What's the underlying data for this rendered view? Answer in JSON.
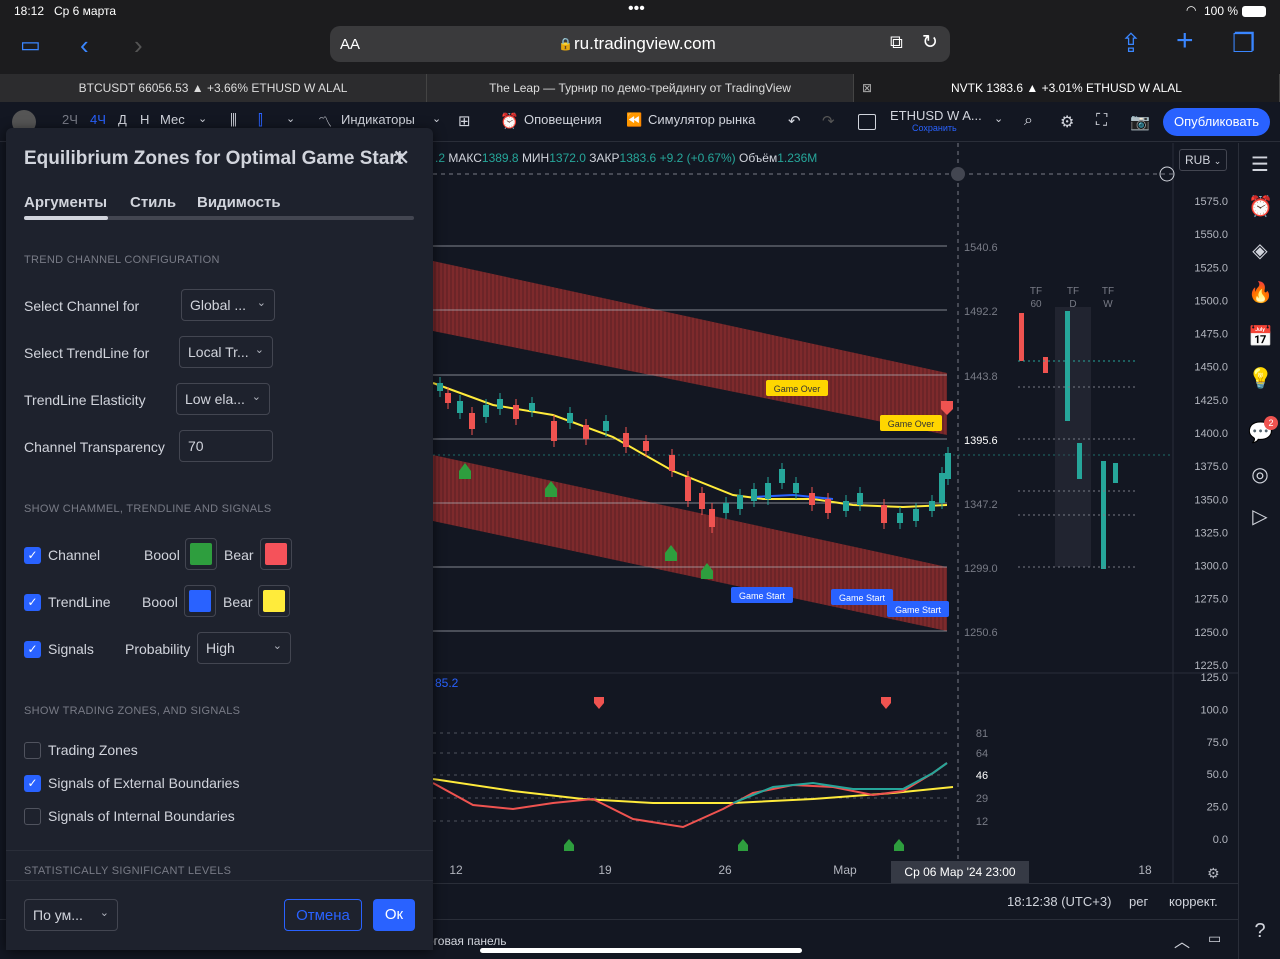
{
  "status": {
    "time": "18:12",
    "date": "Ср 6 марта",
    "battery": "100 %"
  },
  "safari": {
    "aa": "AA",
    "url": "ru.tradingview.com"
  },
  "tabs": [
    {
      "label": "BTCUSDT 66056.53 ▲ +3.66% ETHUSD W ALAL"
    },
    {
      "label": "The Leap — Турнир по демо-трейдингу от TradingView"
    },
    {
      "label": "NVTK 1383.6 ▲ +3.01% ETHUSD W ALAL"
    }
  ],
  "toolbar": {
    "tf_2h": "2Ч",
    "tf_4h": "4Ч",
    "tf_d": "Д",
    "tf_w": "Н",
    "tf_m": "Мес",
    "indicators": "Индикаторы",
    "alerts": "Оповещения",
    "simulator": "Симулятор рынка",
    "layout_name": "ETHUSD W A...",
    "layout_sub": "Сохранить",
    "publish": "Опубликовать"
  },
  "ohlc": {
    "prefix": ".2",
    "high_label": "МАКС",
    "high": "1389.8",
    "low_label": "МИН",
    "low": "1372.0",
    "close_label": "ЗАКР",
    "close": "1383.6",
    "change": "+9.2 (+0.67%)",
    "vol_label": "Объём",
    "vol": "1.236M"
  },
  "currency": "RUB",
  "price_axis": [
    "1575.0",
    "1550.0",
    "1525.0",
    "1500.0",
    "1475.0",
    "1450.0",
    "1425.0",
    "1400.0",
    "1375.0",
    "1350.0",
    "1325.0",
    "1300.0",
    "1275.0",
    "1250.0",
    "1225.0"
  ],
  "price_levels": [
    "1540.6",
    "1492.2",
    "1443.8",
    "1395.6",
    "1347.2",
    "1299.0",
    "1250.6"
  ],
  "osc_axis": [
    "125.0",
    "100.0",
    "75.0",
    "50.0",
    "25.0",
    "0.0"
  ],
  "osc_levels": [
    "81",
    "64",
    "46",
    "29",
    "12"
  ],
  "osc_value": "85.2",
  "mtf": {
    "tf60": "TF 60",
    "tfd": "TF D",
    "tfw": "TF W"
  },
  "labels": {
    "game_over": "Game Over",
    "game_start": "Game Start"
  },
  "time_axis": [
    "12",
    "19",
    "26",
    "Мар",
    "18"
  ],
  "crosshair_time": "Ср 06 Мар '24   23:00",
  "bottom": {
    "clock": "18:12:38 (UTC+3)",
    "per": "рег",
    "adj": "коррект."
  },
  "footer": {
    "trade_panel": "рговая панель"
  },
  "dialog": {
    "title": "Equilibrium Zones for Optimal Game Start",
    "tabs": [
      "Аргументы",
      "Стиль",
      "Видимость"
    ],
    "sec_trend": "TREND CHANNEL CONFIGURATION",
    "select_channel_label": "Select Channel for",
    "select_channel_value": "Global ...",
    "select_trendline_label": "Select TrendLine for",
    "select_trendline_value": "Local Tr...",
    "elasticity_label": "TrendLine Elasticity",
    "elasticity_value": "Low ela...",
    "transparency_label": "Channel Transparency",
    "transparency_value": "70",
    "sec_show": "SHOW CHAMMEL, TRENDLINE AND SIGNALS",
    "channel_label": "Channel",
    "trendline_label": "TrendLine",
    "signals_label": "Signals",
    "bool_label": "Boool",
    "bear_label": "Bear",
    "probability_label": "Probability",
    "probability_value": "High",
    "sec_zones": "SHOW TRADING ZONES, AND SIGNALS",
    "trading_zones": "Trading Zones",
    "ext_boundaries": "Signals of External Boundaries",
    "int_boundaries": "Signals of Internal Boundaries",
    "sec_stat": "STATISTICALLY SIGNIFICANT LEVELS",
    "defaults": "По ум...",
    "cancel": "Отмена",
    "ok": "Ок"
  },
  "colors": {
    "bull": "#26a69a",
    "bear": "#ef5350",
    "accent": "#2962ff",
    "channel_bull": "#2e9e3e",
    "channel_bear": "#f5525a",
    "trend_bull": "#2962ff",
    "trend_bear": "#ffeb3b"
  }
}
